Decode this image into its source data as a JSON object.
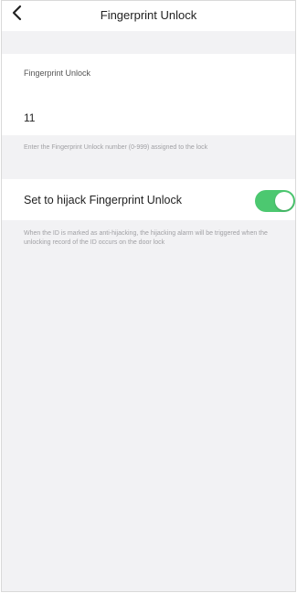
{
  "header": {
    "back_icon": "chevron-left-icon",
    "title": "Fingerprint Unlock"
  },
  "fingerprint": {
    "label": "Fingerprint Unlock",
    "value": "11",
    "hint": "Enter the Fingerprint Unlock number (0-999) assigned to the lock"
  },
  "hijack": {
    "label": "Set to hijack Fingerprint Unlock",
    "enabled": true,
    "toggle_color": "#4cc870",
    "hint": "When the ID is marked as anti-hijacking, the hijacking alarm will be triggered when the unlocking record of the ID occurs on the door lock"
  },
  "colors": {
    "background": "#f2f2f4",
    "card": "#ffffff",
    "hint_text": "#a0a0a4"
  }
}
